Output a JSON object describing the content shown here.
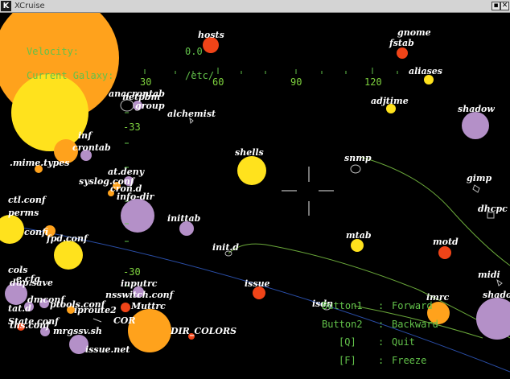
{
  "window": {
    "title": "XCruise",
    "app_icon": "K",
    "minimize_glyph": "▪",
    "close_glyph": "✕"
  },
  "hud": {
    "velocity_label": "Velocity:",
    "velocity_value": "0.0",
    "galaxy_label": "Current Galaxy:",
    "galaxy_value": "/etc/"
  },
  "compass": {
    "top_ticks": [
      "30",
      "60",
      "90",
      "120"
    ],
    "left_ticks": [
      "-33",
      "-30"
    ]
  },
  "help": [
    {
      "key": "Button1",
      "action": "Forward"
    },
    {
      "key": "Button2",
      "action": "Backward"
    },
    {
      "key": "[Q]",
      "action": "Quit"
    },
    {
      "key": "[F]",
      "action": "Freeze"
    }
  ],
  "colors": {
    "yellow": "#ffe21d",
    "orange": "#ffa21c",
    "red": "#f04418",
    "purple": "#b490c8",
    "hud_green": "#62c24a",
    "link_blue": "#2a4ea8",
    "link_green": "#6aa83a"
  },
  "labels": {
    "hosts": "hosts",
    "gnome": "gnome",
    "fstab": "fstab",
    "aliases": "aliases",
    "anacrontab": "anacrontab",
    "netpbm": "netpbm",
    "group": "group",
    "alchemist": "alchemist",
    "adjtime": "adjtime",
    "shadow": "shadow",
    "inf": "inf",
    "crontab": "crontab",
    "mime_types": ".mime.types",
    "shells": "shells",
    "snmp": "snmp",
    "at_deny": "at.deny",
    "syslog_conf": "syslog.conf",
    "cron_d": "cron.d",
    "info_dir": "info-dir",
    "ctl_conf": "ctl.conf",
    "gimp": "gimp",
    "dhcpc": "dhcpc",
    "perms": "perms",
    "inittab": "inittab",
    "confi": "confi",
    "fpd_conf": "fpd.conf",
    "mtab": "mtab",
    "motd": "motd",
    "init_d": "init.d",
    "cols": "cols",
    "e_cfg": "e.cfg",
    "dup_save": "dup.save",
    "issue": "issue",
    "inputrc": "inputrc",
    "midi": "midi",
    "shadow2": "shadow",
    "nsswitch_conf": "nsswitch.conf",
    "ptools_conf": "ptools.conf",
    "muttrc": "Muttrc",
    "iproute2": "iproute2",
    "isdn": "isdn",
    "imrc": "imrc",
    "state_conf": "State.conf",
    "tat_d": "tat.d",
    "cor": "COR",
    "mrgssv_sh": "mrgssv.sh",
    "dir_colors": "DIR_COLORS",
    "issue_net": "issue.net",
    "ths_conf": "ths.conf",
    "dmconf": "dmconf"
  }
}
